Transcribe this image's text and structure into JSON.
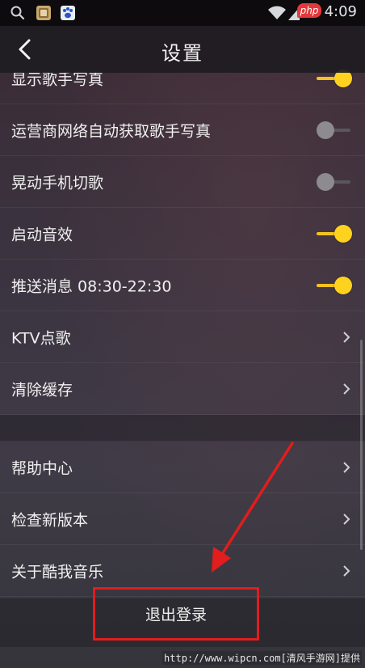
{
  "status_bar": {
    "time": "4:09",
    "badge": "php",
    "icons": [
      "search-icon",
      "app-icon",
      "baidu-paw-icon",
      "wifi-icon",
      "signal-icon"
    ]
  },
  "header": {
    "title": "设置",
    "back_icon": "chevron-left-icon"
  },
  "settings": {
    "toggles": [
      {
        "label": "显示歌手写真",
        "state": "on"
      },
      {
        "label": "运营商网络自动获取歌手写真",
        "state": "off"
      },
      {
        "label": "晃动手机切歌",
        "state": "off"
      },
      {
        "label": "启动音效",
        "state": "on"
      },
      {
        "label": "推送消息 08:30-22:30",
        "state": "on"
      }
    ],
    "links_group1": [
      {
        "label": "KTV点歌"
      },
      {
        "label": "清除缓存"
      }
    ],
    "links_group2": [
      {
        "label": "帮助中心"
      },
      {
        "label": "检查新版本"
      },
      {
        "label": "关于酷我音乐"
      }
    ]
  },
  "logout": {
    "label": "退出登录"
  },
  "watermark": "http://www.wipcn.com[清风手游网]提供",
  "colors": {
    "toggle_on": "#ffd21f",
    "toggle_off": "#8d8a90",
    "annotation": "#e11d1d"
  }
}
